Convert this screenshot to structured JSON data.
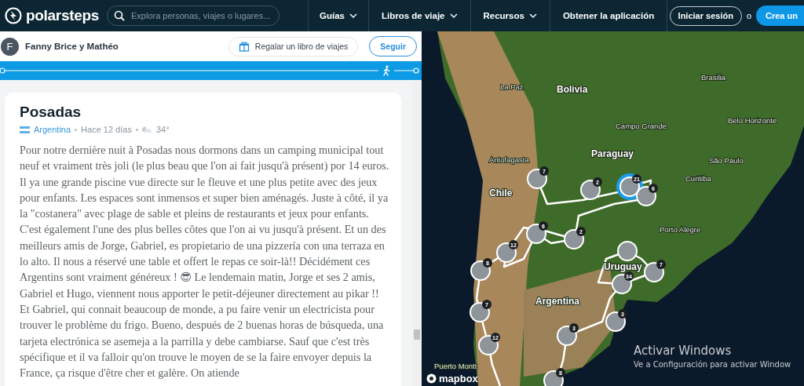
{
  "nav": {
    "logo": "polarsteps",
    "search": {
      "placeholder": "Explora personas, viajes o lugares..."
    },
    "items": [
      {
        "label": "Guías",
        "has_menu": true
      },
      {
        "label": "Libros de viaje",
        "has_menu": true
      },
      {
        "label": "Recursos",
        "has_menu": true
      },
      {
        "label": "Obtener la aplicación",
        "has_menu": false
      }
    ],
    "login": "Iniciar sesión",
    "separator": "o",
    "signup": "Crea un"
  },
  "trip": {
    "avatar": "F",
    "author": "Fanny Brice y Mathéo",
    "gift_button": "Regalar un libro de viajes",
    "follow_button": "Seguir"
  },
  "step": {
    "title": "Posadas",
    "country": "Argentina",
    "time": "Hace 12 días",
    "temperature": "34°",
    "body": "Pour notre dernière nuit à Posadas nous dormons dans un camping municipal tout neuf et vraiment très joli (le plus beau que l'on ai fait jusqu'à présent) por 14 euros. Il ya une grande piscine vue directe sur le fleuve et une plus petite avec des jeux pour enfants. Les espaces sont inmensos et super bien aménagés. Juste à côté, il ya la \"costanera\" avec plage de sable et pleins de restaurants et jeux pour enfants. C'est également l'une des plus belles côtes que l'on ai vu jusqu'à présent. Et un des meilleurs amis de Jorge, Gabriel, es propietario de una pizzería con una terraza en lo alto. Il nous a réservé une table et offert le repas ce soir-là!! Décidément ces Argentins sont vraiment généreux ! 😎 Le lendemain matin, Jorge et ses 2 amis, Gabriel et Hugo, viennent nous apporter le petit-déjeuner directement au pikar !! Et Gabriel, qui connait beaucoup de monde, a pu faire venir un electricista pour trouver le problème du frigo. Bueno, después de 2 buenas horas de búsqueda, una tarjeta electrónica se asemeja a la parrilla y debe cambiarse. Sauf que c'est très spécifique et il va falloir qu'on trouve le moyen de se la faire envoyer depuis la France, ça risque d'être cher et galère. On atiende"
  },
  "map": {
    "labels": [
      {
        "text": "Brasilia",
        "kind": "city"
      },
      {
        "text": "La Paz",
        "kind": "city"
      },
      {
        "text": "Bolivia",
        "kind": "country"
      },
      {
        "text": "Belo Horizonte",
        "kind": "city"
      },
      {
        "text": "Campo Grande",
        "kind": "city"
      },
      {
        "text": "Paraguay",
        "kind": "country"
      },
      {
        "text": "Antofagasta",
        "kind": "city"
      },
      {
        "text": "São Paulo",
        "kind": "city"
      },
      {
        "text": "Curitiba",
        "kind": "city"
      },
      {
        "text": "Chile",
        "kind": "country"
      },
      {
        "text": "Porto Alegre",
        "kind": "city"
      },
      {
        "text": "Uruguay",
        "kind": "country"
      },
      {
        "text": "Argentina",
        "kind": "country"
      },
      {
        "text": "Puerto Montt",
        "kind": "city"
      }
    ],
    "markers": [
      {
        "count": "7",
        "selected": false
      },
      {
        "count": "2",
        "selected": false
      },
      {
        "count": "21",
        "selected": true
      },
      {
        "count": "6",
        "selected": false
      },
      {
        "count": "6",
        "selected": false
      },
      {
        "count": "2",
        "selected": false
      },
      {
        "count": "12",
        "selected": false
      },
      {
        "selected": false
      },
      {
        "count": "8",
        "selected": false
      },
      {
        "count": "7",
        "selected": false
      },
      {
        "count": "34",
        "selected": false
      },
      {
        "count": "7",
        "selected": false
      },
      {
        "count": "3",
        "selected": false
      },
      {
        "count": "3",
        "selected": false
      },
      {
        "count": "12",
        "selected": false
      },
      {
        "count": "8",
        "selected": false
      }
    ],
    "brand": "mapbox"
  },
  "windows_notice": {
    "title": "Activar Windows",
    "text": "Ve a Configuración para activar Window"
  }
}
